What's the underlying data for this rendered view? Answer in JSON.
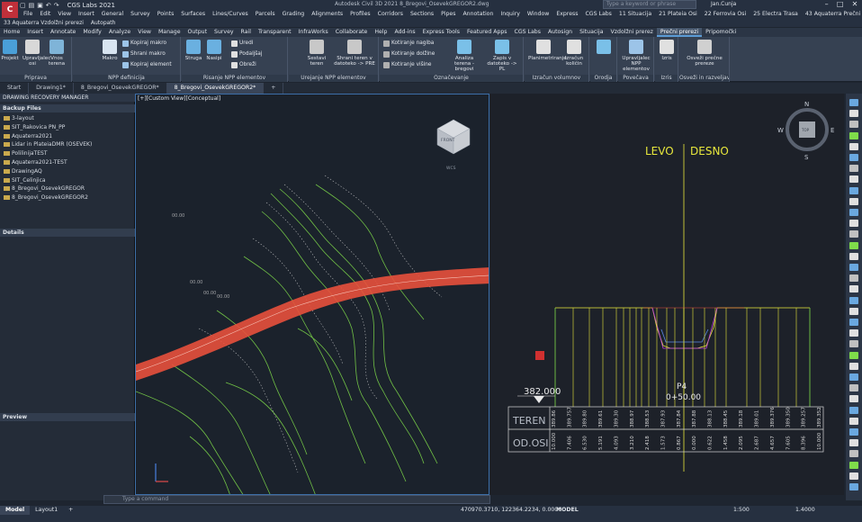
{
  "app": {
    "icon_letter": "C",
    "title": "Autodesk Civil 3D 2021   8_Bregovi_OsevekGREGOR2.dwg",
    "workspace": "CGS Labs 2021",
    "search_placeholder": "Type a keyword or phrase",
    "user": "Jan.Cunja"
  },
  "menu_bar": [
    "File",
    "Edit",
    "View",
    "Insert",
    "General",
    "Survey",
    "Points",
    "Surfaces",
    "Lines/Curves",
    "Parcels",
    "Grading",
    "Alignments",
    "Profiles",
    "Corridors",
    "Sections",
    "Pipes",
    "Annotation",
    "Inquiry",
    "Window",
    "Express",
    "CGS Labs",
    "11 Situacija",
    "21 Plateia Osi",
    "22 Ferrovia Osi",
    "25 Electra Trasa",
    "43 Aquaterra Prečni prerezi"
  ],
  "menu_bar2": [
    "33 Aquaterra Vzdolžni prerezi",
    "Autopath"
  ],
  "ribbon_tabs": [
    "Home",
    "Insert",
    "Annotate",
    "Modify",
    "Analyze",
    "View",
    "Manage",
    "Output",
    "Survey",
    "Rail",
    "Transparent",
    "InfraWorks",
    "Collaborate",
    "Help",
    "Add-ins",
    "Express Tools",
    "Featured Apps",
    "CGS Labs",
    "Autosign",
    "Situacija",
    "Vzdolžni prerez",
    "Prečni prerezi",
    "Pripomočki"
  ],
  "active_ribbon_tab": "Prečni prerezi",
  "ribbon_panels": {
    "priprava": {
      "title": "Priprava",
      "projekt": "Projekt",
      "upravljalec": "Upravljalec osi",
      "vnos": "Vnos terena"
    },
    "npp_definicija": {
      "title": "NPP definicija",
      "makro": "Makro",
      "kopiraj_makro": "Kopiraj makro",
      "shrani_makro": "Shrani makro",
      "kopiraj_element": "Kopiraj element"
    },
    "risanje": {
      "title": "Risanje NPP elementov",
      "struga": "Struga",
      "nasipi": "Nasipi",
      "uredi": "Uredi",
      "podaljsaj": "Podaljšaj",
      "obrezi": "Obreži"
    },
    "urejanje": {
      "title": "Urejanje NPP elementov",
      "sestavi": "Sestavi teren",
      "shrani_teren": "Shrani teren v datoteko -> PRE"
    },
    "oznacevanje": {
      "title": "Označevanje",
      "kot_nagiba": "Kotiranje nagiba",
      "kot_dolzine": "Kotiranje dolžine",
      "kot_visine": "Kotiranje višine",
      "analiza": "Analiza terena - bregovi",
      "zapis": "Zapis v datoteko -> PL"
    },
    "izracun": {
      "title": "Izračun volumnov",
      "planimetriranje": "Planimetriranje",
      "izracun_kolicin": "Izračun količin"
    },
    "orodja": {
      "title": "Orodja"
    },
    "povecava": {
      "title": "Povečava",
      "upravljalec_npp": "Upravljalec NPP elementov"
    },
    "izris": {
      "title": "Izris",
      "izris": "Izris"
    },
    "osvezi": {
      "title": "Osveži in razveljavi",
      "osvezi_prereze": "Osveži prečne prereze"
    }
  },
  "doc_tabs": [
    "Start",
    "Drawing1*",
    "8_Bregovi_OsevekGREGOR*",
    "8_Bregovi_OsevekGREGOR2*"
  ],
  "active_doc_tab": "8_Bregovi_OsevekGREGOR2*",
  "recovery": {
    "header": "DRAWING RECOVERY MANAGER",
    "backup_title": "Backup Files",
    "files": [
      "3-layout",
      "SIT_Rakovica PN_PP",
      "Aquaterra2021",
      "Lidar in PlateiaDMR (OSEVEK)",
      "PolilinijaTEST",
      "Aquaterra2021-TEST",
      "DrawingAQ",
      "SIT_Celinjica",
      "8_Bregovi_OsevekGREGOR",
      "8_Bregovi_OsevekGREGOR2"
    ],
    "details_title": "Details",
    "preview_title": "Preview"
  },
  "viewport_left": {
    "label": "[+][Custom View][Conceptual]",
    "viewcube_face": "FRONT",
    "viewcube_label": "WCS"
  },
  "viewport_right": {
    "compass": {
      "n": "N",
      "s": "S",
      "e": "E",
      "w": "W",
      "top": "TOP"
    },
    "levo": "LEVO",
    "desno": "DESNO",
    "elevation": "382.000",
    "profile_id": "P4",
    "station": "0+50.00",
    "row1_label": "TEREN",
    "row2_label": "OD.OSI",
    "teren_values": [
      "389.86",
      "389.757",
      "389.80",
      "389.61",
      "389.30",
      "388.97",
      "388.53",
      "387.93",
      "387.84",
      "387.88",
      "388.13",
      "388.45",
      "389.18",
      "389.01",
      "389.376",
      "389.350",
      "389.257",
      "389.352"
    ],
    "odosi_values": [
      "10.000",
      "7.406",
      "6.530",
      "5.191",
      "4.093",
      "3.210",
      "2.418",
      "1.573",
      "0.867",
      "0.000",
      "0.622",
      "1.458",
      "2.095",
      "2.687",
      "4.657",
      "7.605",
      "8.396",
      "10.000"
    ]
  },
  "command_placeholder": "Type a command",
  "status": {
    "tabs": [
      "Model",
      "Layout1"
    ],
    "coords": "470970.3710, 122364.2234, 0.0000",
    "mode": "MODEL",
    "scale_text": "1:500",
    "zoom": "1.4000"
  },
  "colors": {
    "accent_blue": "#3c6ea8",
    "terrain_green": "#7fdc4a",
    "road_red": "#e8503c",
    "profile_yellow": "#e8e83c",
    "highlight_magenta": "#c040e0"
  }
}
